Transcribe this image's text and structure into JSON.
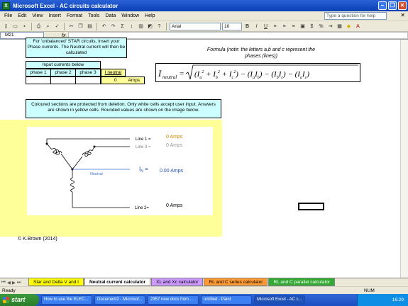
{
  "window": {
    "title": "Microsoft Excel - AC circuits calculator"
  },
  "menu": {
    "items": [
      "File",
      "Edit",
      "View",
      "Insert",
      "Format",
      "Tools",
      "Data",
      "Window",
      "Help"
    ],
    "help_placeholder": "Type a question for help"
  },
  "toolbar": {
    "font": "Arial",
    "size": "10"
  },
  "formula_bar": {
    "name_box": "M21",
    "fx": "fx"
  },
  "sheet": {
    "intro": "For 'unbalanced' STAR circuits, insert your Phase currents. The Neutral current will then be calculated",
    "input_header": "Input currents below",
    "phases": [
      "phase 1",
      "phase 2",
      "phase 3"
    ],
    "neutral_label": "I neutral",
    "neutral_value": "0",
    "neutral_unit": "Amps",
    "formula_note": "Formula (note: the letters a,b and c represent the phases (lines))",
    "protect_note": "Coloured sections are protected from deletion. Only white cells accept user input. Answers are shown in yellow cells. Rounded values are shown on the image below.",
    "circuit": {
      "neutral_word": "Neutral",
      "line1_label": "Line 1 =",
      "line1_value": "0",
      "line3_label": "Line 3 =",
      "line3_value": "0",
      "in_value": "0.00",
      "line2_label": "Line 2=",
      "line2_value": "0",
      "unit": "Amps"
    },
    "copyright": "© K.Brown (2014)"
  },
  "tabs": [
    {
      "label": "Star and Delta V and I",
      "color": "#ffff00",
      "active": false
    },
    {
      "label": "Neutral current calculator",
      "color": "#ffffff",
      "active": true
    },
    {
      "label": "XL and Xc calculator",
      "color": "#cc99ff",
      "active": false
    },
    {
      "label": "RL and C series calculator",
      "color": "#ff9933",
      "active": false
    },
    {
      "label": "RL and C parallel calculator",
      "color": "#33aa33",
      "active": false
    }
  ],
  "status": {
    "left": "Ready",
    "num": "NUM"
  },
  "taskbar": {
    "start": "start",
    "tasks": [
      "How to use the ELEC...",
      "Document2 - Microsof...",
      "2357 new docs from ...",
      "untitled - Paint",
      "Microsoft Excel - AC c..."
    ],
    "clock": "16:29"
  }
}
